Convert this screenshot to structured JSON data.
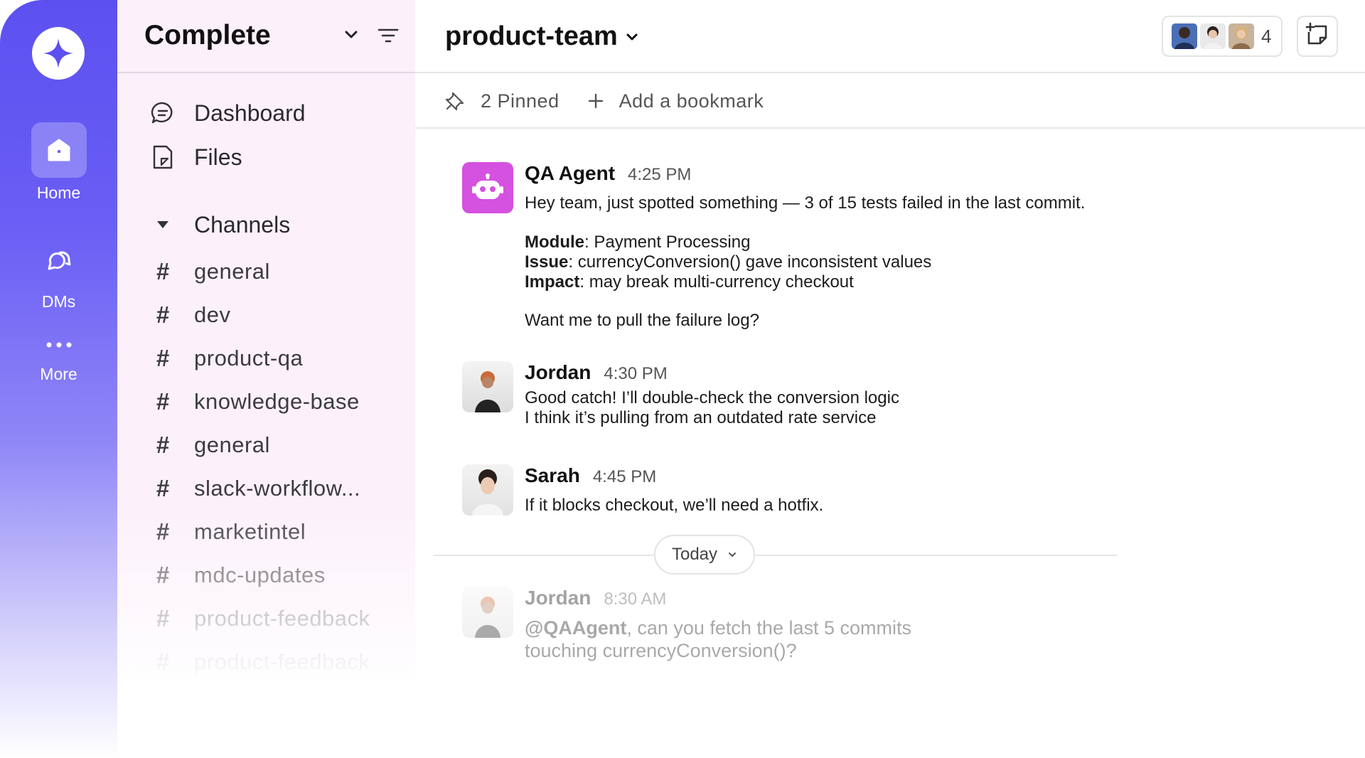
{
  "rail": {
    "items": [
      {
        "label": "Home",
        "icon": "home-icon",
        "active": true
      },
      {
        "label": "DMs",
        "icon": "dms-icon"
      },
      {
        "label": "More",
        "icon": "more-icon"
      }
    ]
  },
  "sidebar": {
    "workspace": "Complete",
    "nav": [
      {
        "label": "Dashboard",
        "icon": "chat-bubble-icon"
      },
      {
        "label": "Files",
        "icon": "file-icon"
      }
    ],
    "channels_header": "Channels",
    "channels": [
      {
        "hash": "#",
        "name": "general"
      },
      {
        "hash": "#",
        "name": "dev"
      },
      {
        "hash": "#",
        "name": "product-qa"
      },
      {
        "hash": "#",
        "name": "knowledge-base"
      },
      {
        "hash": "#",
        "name": "general"
      },
      {
        "hash": "#",
        "name": "slack-workflow..."
      },
      {
        "hash": "#",
        "name": "marketintel"
      },
      {
        "hash": "#",
        "name": "mdc-updates"
      },
      {
        "hash": "#",
        "name": "product-feedback"
      },
      {
        "hash": "#",
        "name": "product-feedback"
      }
    ]
  },
  "header": {
    "channel": "product-team",
    "member_count": "4"
  },
  "bookmarks": {
    "pinned": "2 Pinned",
    "add": "Add a bookmark"
  },
  "messages": [
    {
      "author": "QA Agent",
      "time": "4:25 PM",
      "line1": "Hey team, just spotted something — 3 of 15 tests failed in the last commit.",
      "module_label": "Module",
      "module_value": ": Payment Processing",
      "issue_label": "Issue",
      "issue_value": ": currencyConversion() gave inconsistent values",
      "impact_label": "Impact",
      "impact_value": ": may break multi-currency checkout",
      "question": "Want me to pull the failure log?"
    },
    {
      "author": "Jordan",
      "time": "4:30 PM",
      "line1": "Good catch! I’ll double-check the conversion logic",
      "line2": "I think it’s pulling from an outdated rate service"
    },
    {
      "author": "Sarah",
      "time": "4:45 PM",
      "line1": "If it blocks checkout, we’ll need a hotfix."
    },
    {
      "author": "Jordan",
      "time": "8:30 AM",
      "mention": "@QAAgent",
      "line1": ", can you fetch the last 5 commits",
      "line2": "touching currencyConversion()?"
    }
  ],
  "divider": {
    "label": "Today"
  },
  "colors": {
    "rail": "#5c50f0",
    "sidebar": "#fcf0fa",
    "agent_avatar": "#d551e0"
  }
}
